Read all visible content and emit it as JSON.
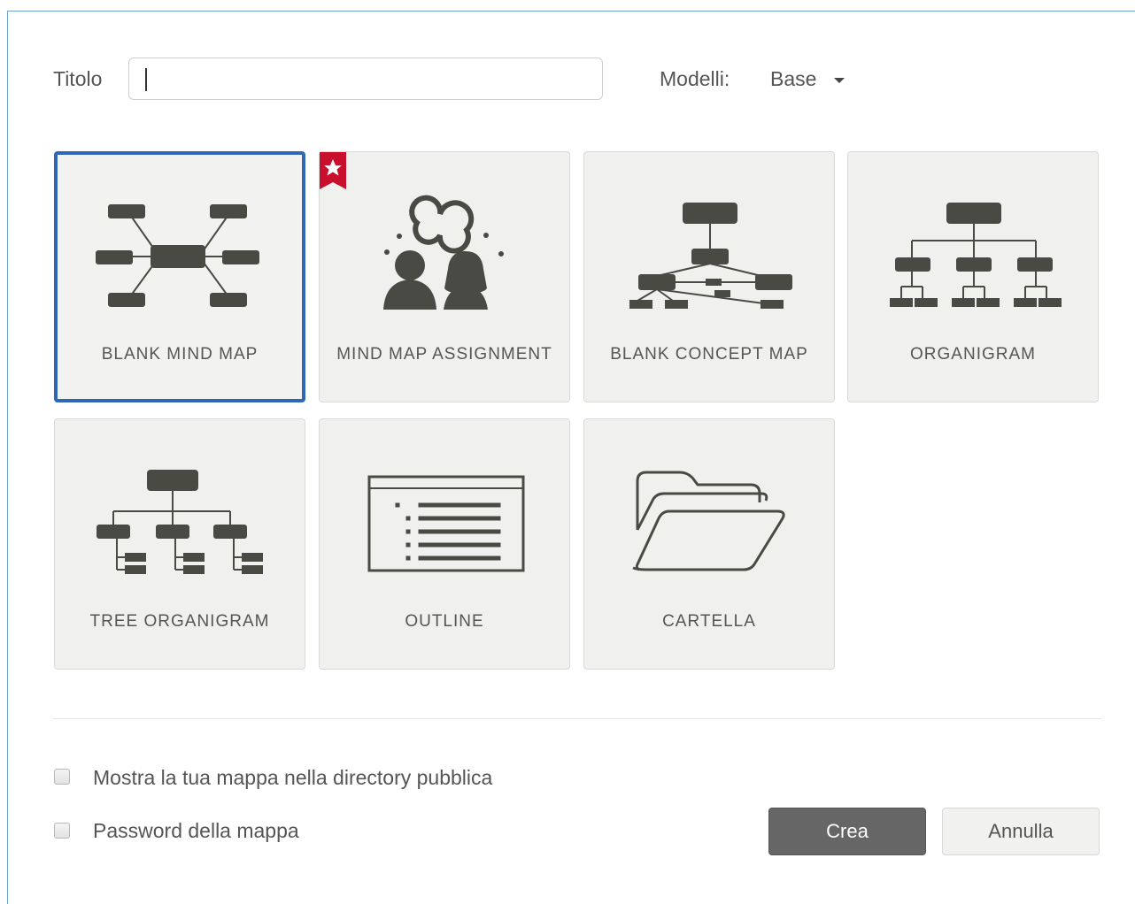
{
  "form": {
    "title_label": "Titolo",
    "title_value": "",
    "models_label": "Modelli:",
    "models_selected": "Base"
  },
  "templates": [
    {
      "label": "BLANK MIND MAP",
      "icon": "mind-map-icon",
      "selected": true
    },
    {
      "label": "MIND MAP ASSIGNMENT",
      "icon": "assignment-people-icon",
      "badge": "star-ribbon-icon"
    },
    {
      "label": "BLANK CONCEPT MAP",
      "icon": "concept-map-icon"
    },
    {
      "label": "ORGANIGRAM",
      "icon": "organigram-icon"
    },
    {
      "label": "TREE ORGANIGRAM",
      "icon": "tree-organigram-icon"
    },
    {
      "label": "OUTLINE",
      "icon": "outline-icon"
    },
    {
      "label": "CARTELLA",
      "icon": "folder-icon"
    }
  ],
  "options": {
    "public_directory_label": "Mostra la tua mappa nella directory pubblica",
    "password_label": "Password della mappa"
  },
  "buttons": {
    "create_label": "Crea",
    "cancel_label": "Annulla"
  },
  "colors": {
    "selected_border": "#2f67b5",
    "icon_fill": "#4a4a44",
    "ribbon": "#c8102e",
    "primary_button": "#666666"
  }
}
